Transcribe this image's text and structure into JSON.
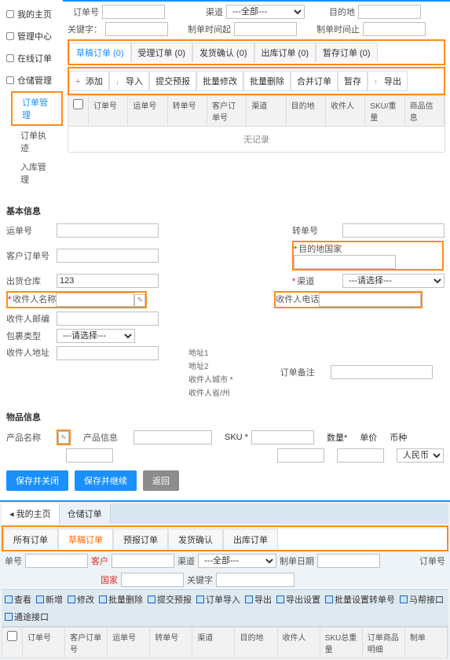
{
  "sidebar": {
    "items": [
      {
        "label": "我的主页"
      },
      {
        "label": "管理中心"
      },
      {
        "label": "在线订单"
      },
      {
        "label": "仓储管理"
      }
    ],
    "sub": [
      {
        "label": "订单管理"
      },
      {
        "label": "订单执迹"
      },
      {
        "label": "入库管理"
      }
    ]
  },
  "filters": {
    "order_no_lbl": "订单号",
    "channel_lbl": "渠道",
    "channel_all": "---全部---",
    "dest_lbl": "目的地",
    "keyword_lbl": "关键字：",
    "create_time_lbl": "制单时间起",
    "create_time_end_lbl": "制单时间止"
  },
  "tabs": [
    {
      "label": "草稿订单 (0)"
    },
    {
      "label": "受理订单 (0)"
    },
    {
      "label": "发货确认 (0)"
    },
    {
      "label": "出库订单 (0)"
    },
    {
      "label": "暂存订单 (0)"
    }
  ],
  "toolbar": [
    {
      "label": "添加",
      "icon": "plus"
    },
    {
      "label": "导入",
      "icon": "down"
    },
    {
      "label": "提交预报",
      "icon": ""
    },
    {
      "label": "批量修改",
      "icon": ""
    },
    {
      "label": "批量删除",
      "icon": ""
    },
    {
      "label": "合并订单",
      "icon": ""
    },
    {
      "label": "暂存",
      "icon": ""
    },
    {
      "label": "导出",
      "icon": "up"
    }
  ],
  "thead": [
    "订单号",
    "运单号",
    "转单号",
    "客户订单号",
    "渠道",
    "目的地",
    "收件人",
    "SKU/重量",
    "商品信息"
  ],
  "empty": "无记录",
  "basic": {
    "title": "基本信息",
    "ship_no": "运单号",
    "cust_order": "客户订单号",
    "out_wh": "出货仓库",
    "out_wh_val": "123",
    "recv_name": "收件人名称",
    "recv_zip": "收件人邮编",
    "pkg_type": "包裹类型",
    "pkg_ph": "---请选择---",
    "recv_addr": "收件人地址",
    "addr1": "地址1",
    "addr2": "地址2",
    "recv_city": "收件人城市 *",
    "recv_prov": "收件人省/州",
    "trans_no": "转单号",
    "dest_country": "目的地国家",
    "channel": "渠道",
    "channel_ph": "---请选择---",
    "recv_phone": "收件人电话",
    "order_remark": "订单备注"
  },
  "goods": {
    "title": "物品信息",
    "prod_name": "产品名称",
    "prod_info": "产品信息",
    "sku": "SKU *",
    "qty": "数量*",
    "price": "单价",
    "currency": "币种",
    "currency_val": "人民币"
  },
  "buttons": {
    "save_close": "保存并关闭",
    "save_cont": "保存并继续",
    "back": "返回"
  },
  "bottom": {
    "home": "我的主页",
    "wh_order": "仓储订单",
    "subtabs": [
      "所有订单",
      "草稿订单",
      "预报订单",
      "发货确认",
      "出库订单"
    ],
    "q": {
      "order": "单号",
      "cust": "客户",
      "country": "国家",
      "channel": "渠道",
      "all": "---全部---",
      "date": "制单日期",
      "kw": "关键字",
      "on": "订单号"
    },
    "actions": [
      "查看",
      "新增",
      "修改",
      "批量删除",
      "提交预报",
      "订单导入",
      "导出",
      "导出设置",
      "批量设置转单号",
      "马帮接口",
      "通途接口"
    ],
    "bthead": [
      "订单号",
      "客户订单号",
      "运单号",
      "转单号",
      "渠道",
      "目的地",
      "收件人",
      "SKU总重量",
      "订单商品明细",
      "制单"
    ]
  }
}
